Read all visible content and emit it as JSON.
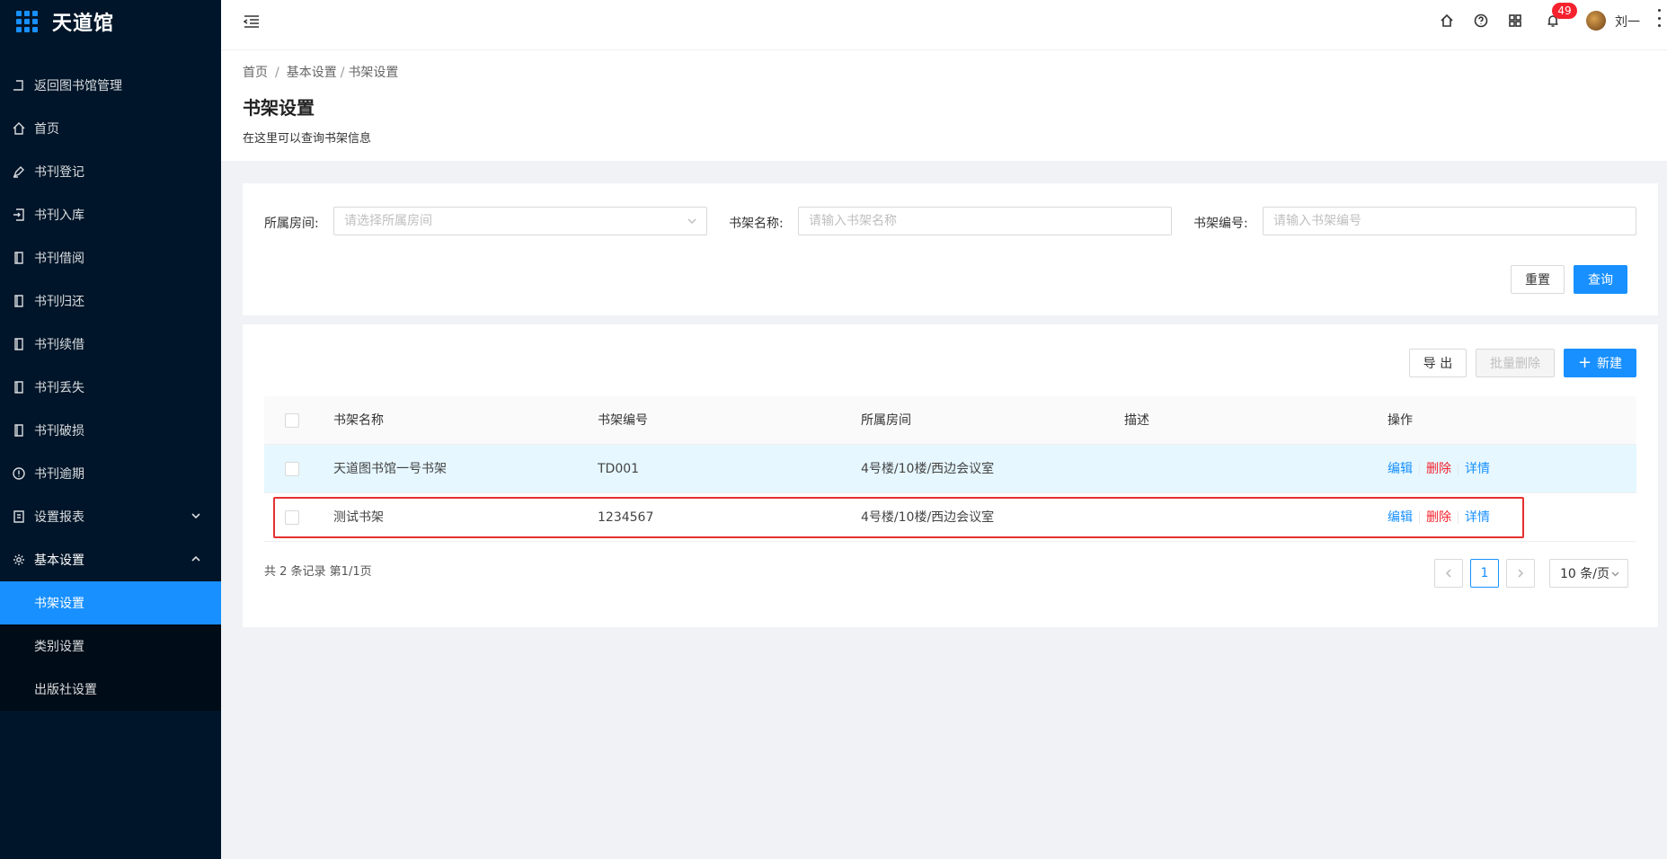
{
  "app": {
    "title": "天道馆"
  },
  "sidebar": {
    "items": [
      {
        "label": "返回图书馆管理",
        "icon": "return-icon"
      },
      {
        "label": "首页",
        "icon": "home-icon"
      },
      {
        "label": "书刊登记",
        "icon": "pen-icon"
      },
      {
        "label": "书刊入库",
        "icon": "import-icon"
      },
      {
        "label": "书刊借阅",
        "icon": "book-icon"
      },
      {
        "label": "书刊归还",
        "icon": "book-icon"
      },
      {
        "label": "书刊续借",
        "icon": "book-icon"
      },
      {
        "label": "书刊丢失",
        "icon": "book-icon"
      },
      {
        "label": "书刊破损",
        "icon": "book-icon"
      },
      {
        "label": "书刊逾期",
        "icon": "alert-circle-icon"
      },
      {
        "label": "设置报表",
        "icon": "report-icon"
      },
      {
        "label": "基本设置",
        "icon": "gear-icon"
      }
    ],
    "submenu": [
      {
        "label": "书架设置",
        "active": true
      },
      {
        "label": "类别设置",
        "active": false
      },
      {
        "label": "出版社设置",
        "active": false
      }
    ]
  },
  "header": {
    "notification_count": "49",
    "username": "刘一"
  },
  "page": {
    "breadcrumb": [
      "首页",
      "基本设置",
      "书架设置"
    ],
    "title": "书架设置",
    "description": "在这里可以查询书架信息"
  },
  "search": {
    "room_label": "所属房间:",
    "room_placeholder": "请选择所属房间",
    "name_label": "书架名称:",
    "name_placeholder": "请输入书架名称",
    "code_label": "书架编号:",
    "code_placeholder": "请输入书架编号",
    "reset_label": "重置",
    "query_label": "查询"
  },
  "toolbar": {
    "export_label": "导 出",
    "batch_delete_label": "批量删除",
    "new_label": "新建"
  },
  "table": {
    "columns": [
      "书架名称",
      "书架编号",
      "所属房间",
      "描述",
      "操作"
    ],
    "rows": [
      {
        "name": "天道图书馆一号书架",
        "code": "TD001",
        "room": "4号楼/10楼/西边会议室",
        "desc": ""
      },
      {
        "name": "测试书架",
        "code": "1234567",
        "room": "4号楼/10楼/西边会议室",
        "desc": ""
      }
    ],
    "actions": {
      "edit": "编辑",
      "delete": "删除",
      "detail": "详情"
    }
  },
  "pagination": {
    "summary": "共 2 条记录 第1/1页",
    "current": "1",
    "page_size": "10 条/页"
  },
  "colors": {
    "sidebar_bg": "#001529",
    "primary": "#1890ff",
    "danger": "#f5222d"
  }
}
